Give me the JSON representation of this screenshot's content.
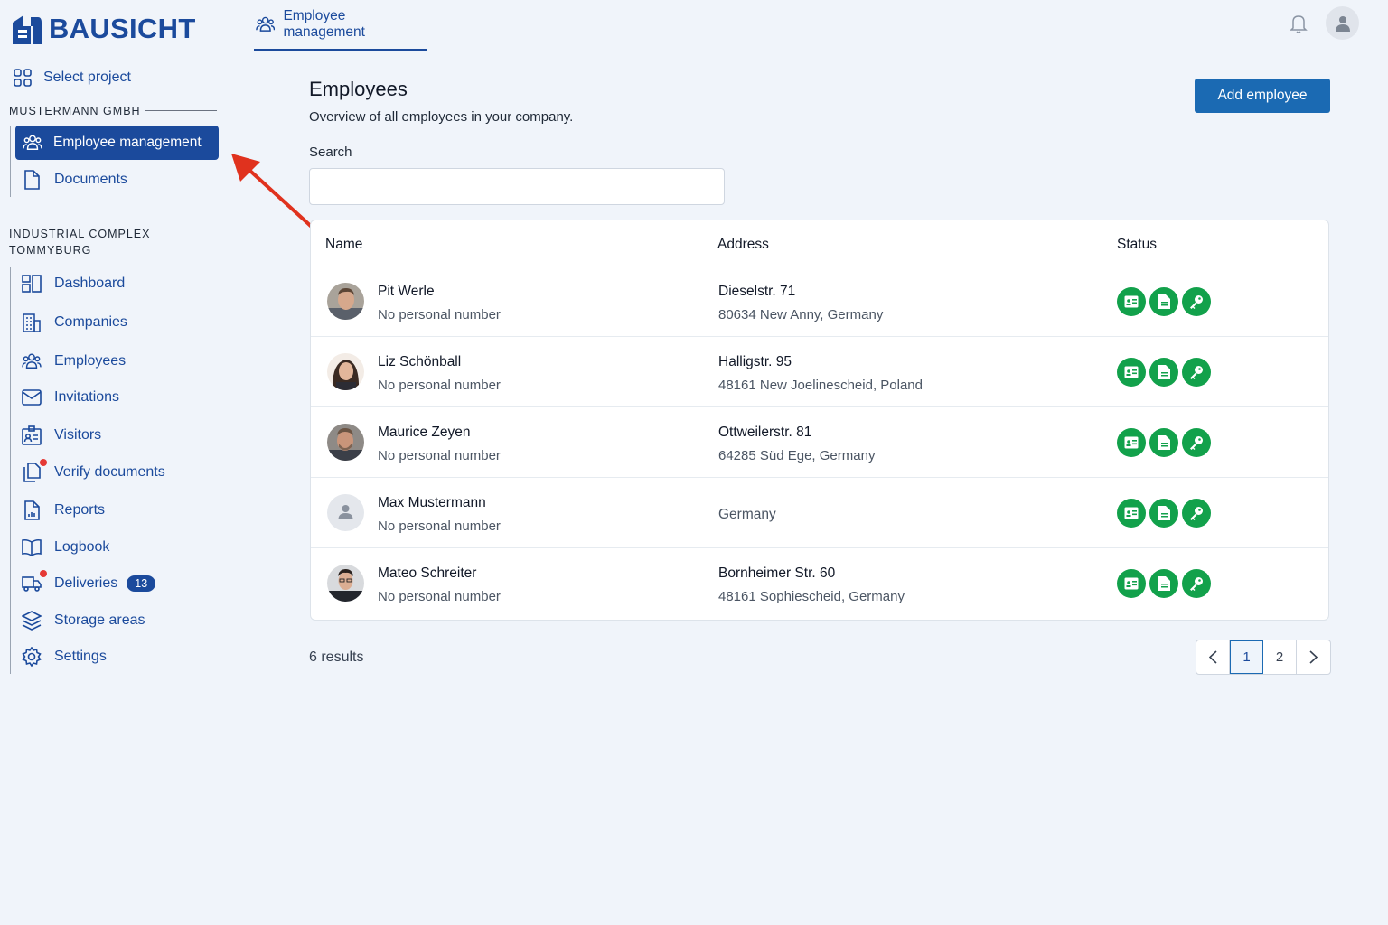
{
  "brand": {
    "name": "BAUSICHT",
    "color": "#1b4a9c"
  },
  "top_tab": {
    "label": "Employee management",
    "icon": "users-icon"
  },
  "sidebar": {
    "select_project": "Select project",
    "company_label": "MUSTERMANN GMBH",
    "company_items": [
      {
        "label": "Employee management",
        "icon": "users-icon",
        "active": true
      },
      {
        "label": "Documents",
        "icon": "document-icon"
      }
    ],
    "project_label_line1": "INDUSTRIAL COMPLEX",
    "project_label_line2": "TOMMYBURG",
    "project_items": [
      {
        "label": "Dashboard",
        "icon": "dashboard-icon"
      },
      {
        "label": "Companies",
        "icon": "building-icon"
      },
      {
        "label": "Employees",
        "icon": "users-icon"
      },
      {
        "label": "Invitations",
        "icon": "envelope-icon"
      },
      {
        "label": "Visitors",
        "icon": "id-card-icon"
      },
      {
        "label": "Verify documents",
        "icon": "documents-icon",
        "notification_dot": true
      },
      {
        "label": "Reports",
        "icon": "report-icon"
      },
      {
        "label": "Logbook",
        "icon": "book-icon"
      },
      {
        "label": "Deliveries",
        "icon": "truck-icon",
        "notification_dot": true,
        "badge": "13"
      },
      {
        "label": "Storage areas",
        "icon": "layers-icon"
      },
      {
        "label": "Settings",
        "icon": "gear-icon"
      }
    ]
  },
  "main": {
    "title": "Employees",
    "subtitle": "Overview of all employees in your company.",
    "add_button": "Add employee",
    "search_label": "Search",
    "search_value": "",
    "columns": [
      "Name",
      "Address",
      "Status"
    ],
    "rows": [
      {
        "name": "Pit Werle",
        "personal_number": "No personal number",
        "address_line1": "Dieselstr. 71",
        "address_line2": "80634 New Anny, Germany"
      },
      {
        "name": "Liz Schönball",
        "personal_number": "No personal number",
        "address_line1": "Halligstr. 95",
        "address_line2": "48161 New Joelinescheid, Poland"
      },
      {
        "name": "Maurice Zeyen",
        "personal_number": "No personal number",
        "address_line1": "Ottweilerstr. 81",
        "address_line2": "64285 Süd Ege, Germany"
      },
      {
        "name": "Max Mustermann",
        "personal_number": "No personal number",
        "address_line1": "",
        "address_line2": "Germany"
      },
      {
        "name": "Mateo Schreiter",
        "personal_number": "No personal number",
        "address_line1": "Bornheimer Str. 60",
        "address_line2": "48161 Sophiescheid, Germany"
      }
    ],
    "status_icons": [
      "id-card-icon",
      "document-icon",
      "key-icon"
    ],
    "status_color": "#12a14b",
    "results": "6 results",
    "pagination": {
      "pages": [
        "1",
        "2"
      ],
      "current": "1"
    }
  }
}
